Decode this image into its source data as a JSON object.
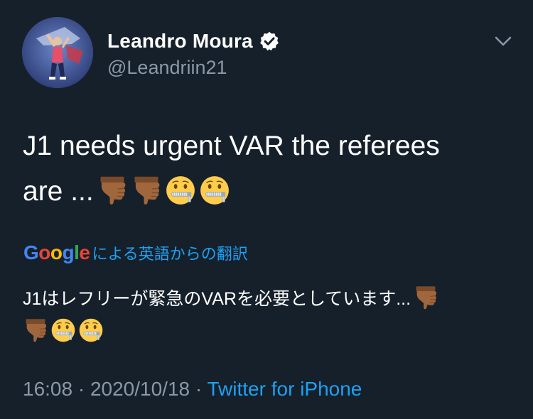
{
  "author": {
    "display_name": "Leandro Moura",
    "handle": "@Leandriin21",
    "verified": true,
    "avatar_icon": "avatar-photo"
  },
  "menu": {
    "icon": "chevron-down-icon"
  },
  "tweet": {
    "line1": "J1 needs urgent VAR the referees",
    "line2_text": "are ...",
    "emojis": [
      "thumbs-down-medium-dark-skin",
      "thumbs-down-medium-dark-skin",
      "zipper-mouth-face",
      "zipper-mouth-face"
    ]
  },
  "translation": {
    "provider_logo": "Google",
    "label": "による英語からの翻訳",
    "line1_text": "J1はレフリーが緊急のVARを必要としています...",
    "line1_emojis": [
      "thumbs-down-medium-dark-skin"
    ],
    "line2_emojis": [
      "thumbs-down-medium-dark-skin",
      "zipper-mouth-face",
      "zipper-mouth-face"
    ]
  },
  "meta": {
    "time": "16:08",
    "separator1": " · ",
    "date": "2020/10/18",
    "separator2": " · ",
    "source": "Twitter for iPhone"
  },
  "colors": {
    "background": "#15202b",
    "primary_text": "#ffffff",
    "secondary_text": "#8b98a5",
    "accent": "#1da1f2"
  }
}
